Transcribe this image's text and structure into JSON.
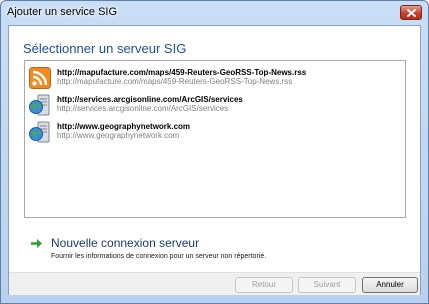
{
  "window": {
    "title": "Ajouter un service SIG"
  },
  "heading": "Sélectionner un serveur SIG",
  "servers": [
    {
      "icon": "rss-feed-icon",
      "url": "http://mapufacture.com/maps/459-Reuters-GeoRSS-Top-News.rss",
      "subtitle": "http://mapufacture.com/maps/459-Reuters-GeoRSS-Top-News.rss"
    },
    {
      "icon": "globe-server-icon",
      "url": "http://services.arcgisonline.com/ArcGIS/services",
      "subtitle": "http://services.arcgisonline.com/ArcGIS/services"
    },
    {
      "icon": "globe-server-icon",
      "url": "http://www.geographynetwork.com",
      "subtitle": "http://www.geographynetwork.com"
    }
  ],
  "new_connection": {
    "title": "Nouvelle connexion serveur",
    "description": "Fournir les informations de connexion pour un serveur non répertorié."
  },
  "buttons": {
    "back": "Retour",
    "next": "Suivant",
    "cancel": "Annuler"
  },
  "colors": {
    "heading": "#1e4f9c",
    "arrow": "#2ea02e",
    "close_button": "#c7402c"
  }
}
